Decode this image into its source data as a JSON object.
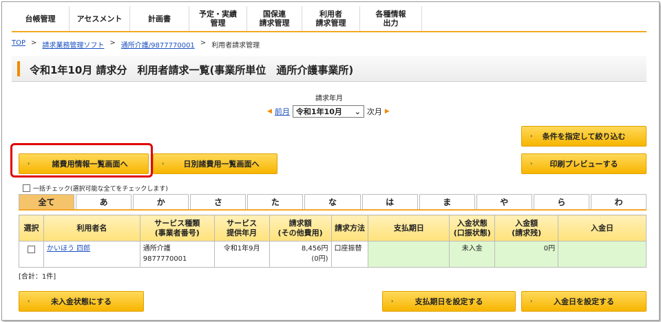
{
  "nav": {
    "items": [
      "台帳管理",
      "アセスメント",
      "計画書",
      "予定・実績\n管理",
      "国保連\n請求管理",
      "利用者\n請求管理",
      "各種情報\n出力"
    ]
  },
  "breadcrumb": {
    "top": "TOP",
    "sep": ">",
    "software": "請求業務管理ソフト",
    "office": "通所介護/9877770001",
    "current": "利用者請求管理"
  },
  "page_title": "令和1年10月 請求分　利用者請求一覧(事業所単位　通所介護事業所)",
  "month": {
    "label": "請求年月",
    "prev": "前月",
    "selected": "令和1年10月",
    "next": "次月"
  },
  "buttons": {
    "filter": "条件を指定して絞り込む",
    "expense_list": "諸費用情報一覧画面へ",
    "daily_expense": "日別諸費用一覧画面へ",
    "print_preview": "印刷プレビューする",
    "set_unpaid": "未入金状態にする",
    "set_due_date": "支払期日を設定する",
    "set_payment_date": "入金日を設定する"
  },
  "check_all_label": "一括チェック(選択可能な全てをチェックします)",
  "kana_tabs": [
    "全て",
    "あ",
    "か",
    "さ",
    "た",
    "な",
    "は",
    "ま",
    "や",
    "ら",
    "わ"
  ],
  "table": {
    "headers": [
      "選択",
      "利用者名",
      "サービス種類\n(事業者番号)",
      "サービス\n提供年月",
      "請求額\n(その他費用)",
      "請求方法",
      "支払期日",
      "入金状態\n(口振状態)",
      "入金額\n(請求残)",
      "入金日"
    ],
    "rows": [
      {
        "name": "かいほう 四郎",
        "service": "通所介護",
        "office_no": "9877770001",
        "month": "令和1年9月",
        "amount": "8,456円",
        "other": "(0円)",
        "method": "口座振替",
        "due": "",
        "status": "未入金",
        "paid": "0円",
        "paid_date": ""
      }
    ]
  },
  "total": "[合計：1件]",
  "colors": {
    "accent": "#f5a623",
    "button": "#f7b500",
    "highlight": "#e00000",
    "link": "#1a4fc0"
  }
}
